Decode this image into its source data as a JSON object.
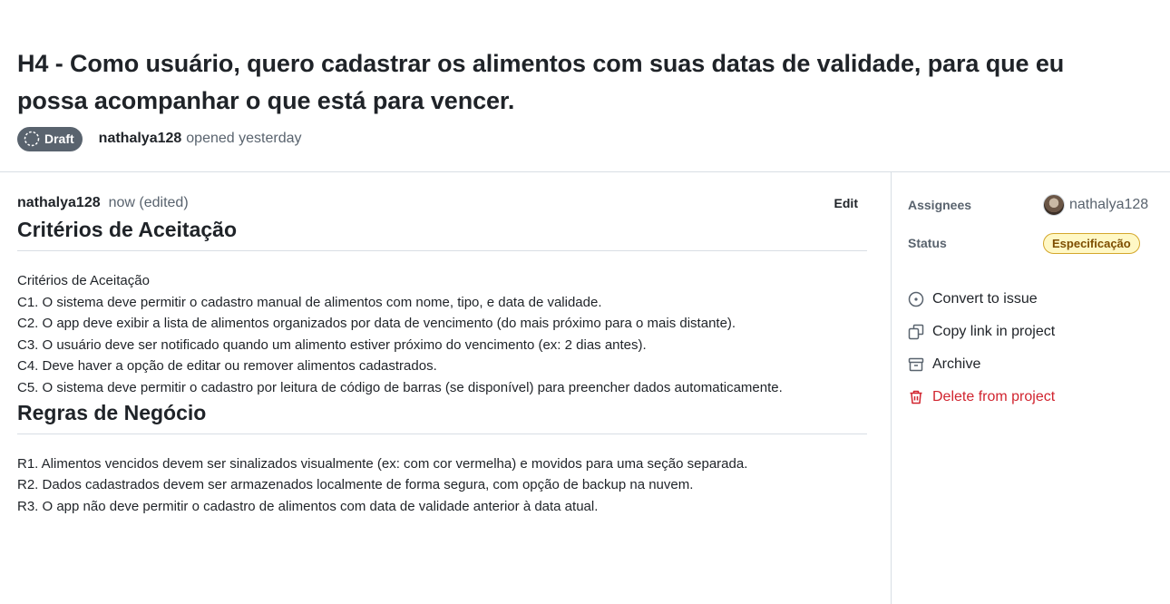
{
  "header": {
    "title": "H4 - Como usuário, quero cadastrar os alimentos com suas datas de validade, para que eu possa acompanhar o que está para vencer.",
    "state_badge": "Draft",
    "author": "nathalya128",
    "opened_text": "opened yesterday"
  },
  "comment": {
    "author": "nathalya128",
    "time": "now (edited)",
    "edit_label": "Edit",
    "sections": [
      {
        "heading": "Critérios de Aceitação",
        "lines": [
          "Critérios de Aceitação",
          "C1. O sistema deve permitir o cadastro manual de alimentos com nome, tipo, e data de validade.",
          "C2. O app deve exibir a lista de alimentos organizados por data de vencimento (do mais próximo para o mais distante).",
          "C3. O usuário deve ser notificado quando um alimento estiver próximo do vencimento (ex: 2 dias antes).",
          "C4. Deve haver a opção de editar ou remover alimentos cadastrados.",
          "C5. O sistema deve permitir o cadastro por leitura de código de barras (se disponível) para preencher dados automaticamente."
        ]
      },
      {
        "heading": "Regras de Negócio",
        "lines": [
          "R1. Alimentos vencidos devem ser sinalizados visualmente (ex: com cor vermelha) e movidos para uma seção separada.",
          "R2. Dados cadastrados devem ser armazenados localmente de forma segura, com opção de backup na nuvem.",
          "R3. O app não deve permitir o cadastro de alimentos com data de validade anterior à data atual."
        ]
      }
    ]
  },
  "sidebar": {
    "assignees_label": "Assignees",
    "assignee_name": "nathalya128",
    "status_label": "Status",
    "status_value": "Especificação",
    "actions": [
      {
        "label": "Convert to issue",
        "icon": "issue-opened-icon"
      },
      {
        "label": "Copy link in project",
        "icon": "copy-icon"
      },
      {
        "label": "Archive",
        "icon": "archive-icon"
      },
      {
        "label": "Delete from project",
        "icon": "trash-icon"
      }
    ]
  },
  "colors": {
    "danger": "#d1242f",
    "draft_badge": "#59636e",
    "status_bg": "#fff8c5",
    "status_border": "#d4a72c",
    "status_text": "#7d4e00"
  }
}
